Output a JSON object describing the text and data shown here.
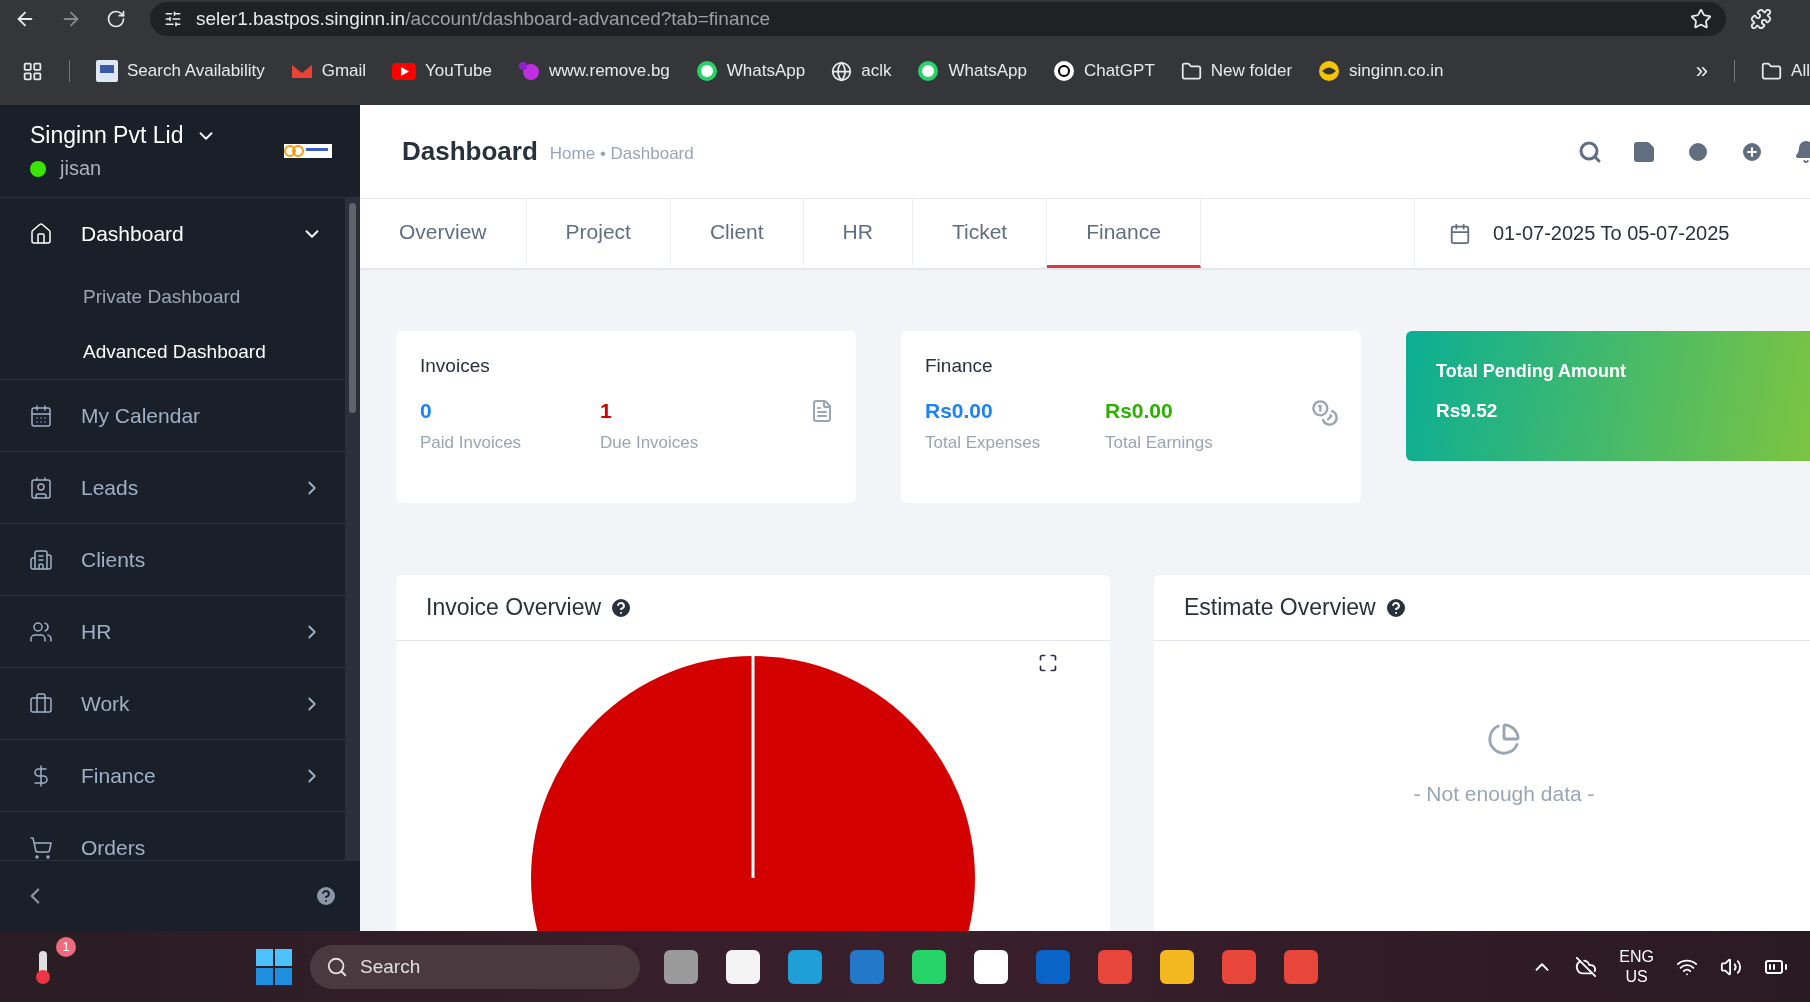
{
  "browser": {
    "url_host": "seler1.bastpos.singinn.in",
    "url_path": "/account/dashboard-advanced?tab=finance",
    "bookmarks": [
      {
        "label": "Search Availability",
        "kind": "site"
      },
      {
        "label": "Gmail",
        "kind": "gmail"
      },
      {
        "label": "YouTube",
        "kind": "youtube"
      },
      {
        "label": "www.remove.bg",
        "kind": "removebg"
      },
      {
        "label": "WhatsApp",
        "kind": "whatsapp"
      },
      {
        "label": "aclk",
        "kind": "globe"
      },
      {
        "label": "WhatsApp",
        "kind": "whatsapp"
      },
      {
        "label": "ChatGPT",
        "kind": "chatgpt"
      },
      {
        "label": "New folder",
        "kind": "folder"
      },
      {
        "label": "singinn.co.in",
        "kind": "site2"
      }
    ],
    "more": "»",
    "all_bookmarks": "All"
  },
  "sidebar": {
    "company": "Singinn Pvt Lid",
    "user": "jisan",
    "online": true,
    "items": [
      {
        "label": "Dashboard",
        "expanded": true,
        "children": [
          {
            "label": "Private Dashboard",
            "selected": false
          },
          {
            "label": "Advanced Dashboard",
            "selected": true
          }
        ]
      },
      {
        "label": "My Calendar"
      },
      {
        "label": "Leads",
        "expanded": false
      },
      {
        "label": "Clients"
      },
      {
        "label": "HR",
        "expanded": false
      },
      {
        "label": "Work",
        "expanded": false
      },
      {
        "label": "Finance",
        "expanded": false
      },
      {
        "label": "Orders"
      }
    ]
  },
  "header": {
    "title": "Dashboard",
    "breadcrumb": "Home • Dashboard"
  },
  "tabs": [
    {
      "label": "Overview",
      "selected": false
    },
    {
      "label": "Project",
      "selected": false
    },
    {
      "label": "Client",
      "selected": false
    },
    {
      "label": "HR",
      "selected": false
    },
    {
      "label": "Ticket",
      "selected": false
    },
    {
      "label": "Finance",
      "selected": true
    }
  ],
  "date_range": "01-07-2025 To 05-07-2025",
  "stat_cards": [
    {
      "title": "Invoices",
      "stats": [
        {
          "value": "0",
          "label": "Paid Invoices",
          "color": "#1d82f5"
        },
        {
          "value": "1",
          "label": "Due Invoices",
          "color": "#d30000"
        }
      ]
    },
    {
      "title": "Finance",
      "stats": [
        {
          "value": "Rs0.00",
          "label": "Total Expenses",
          "color": "#1d82f5"
        },
        {
          "value": "Rs0.00",
          "label": "Total Earnings",
          "color": "#2cb100"
        }
      ]
    }
  ],
  "pending": {
    "title": "Total Pending Amount",
    "value": "Rs9.52"
  },
  "charts": [
    {
      "title": "Invoice Overview",
      "kind": "pie"
    },
    {
      "title": "Estimate Overview",
      "kind": "empty",
      "empty_text": "- Not enough data -"
    }
  ],
  "taskbar": {
    "search": "Search",
    "badge": "1",
    "lang": "ENG",
    "region": "US"
  }
}
